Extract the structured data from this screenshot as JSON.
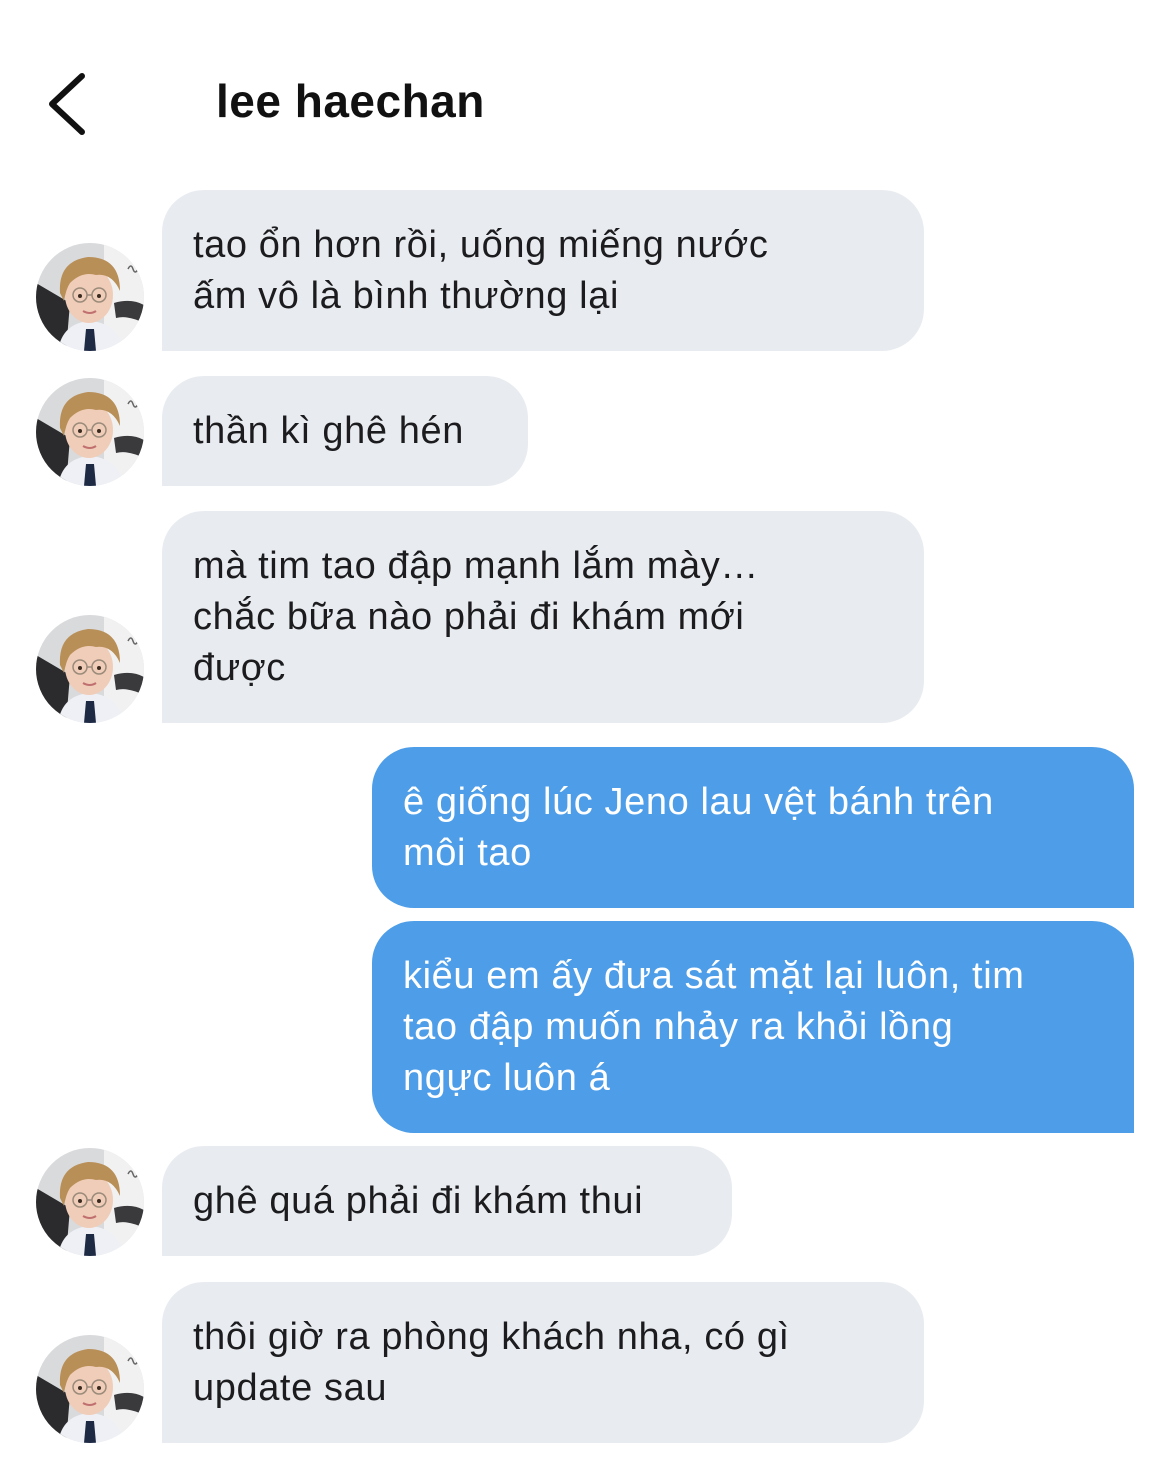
{
  "header": {
    "title": "lee haechan",
    "back_icon": "chevron-left-icon"
  },
  "colors": {
    "received_bubble": "#e8ecf1",
    "sent_bubble": "#4d9de8",
    "sent_text": "#ffffff",
    "received_text": "#1c1c1e"
  },
  "messages": [
    {
      "sender": "other",
      "text": "tao ổn hơn rồi, uống miếng nước\nấm vô là bình thường lại"
    },
    {
      "sender": "other",
      "text": "thần kì ghê hén"
    },
    {
      "sender": "other",
      "text": "mà tim tao đập mạnh lắm mày…\nchắc bữa nào phải đi khám mới\nđược"
    },
    {
      "sender": "me",
      "text": "ê giống lúc Jeno lau vệt bánh trên\nmôi tao"
    },
    {
      "sender": "me",
      "text": "kiểu em ấy đưa sát mặt lại luôn, tim\ntao đập muốn nhảy ra khỏi lồng\nngực luôn á"
    },
    {
      "sender": "other",
      "text": "ghê quá phải đi khám thui"
    },
    {
      "sender": "other",
      "text": "thôi giờ ra phòng khách nha, có gì\nupdate sau"
    }
  ]
}
